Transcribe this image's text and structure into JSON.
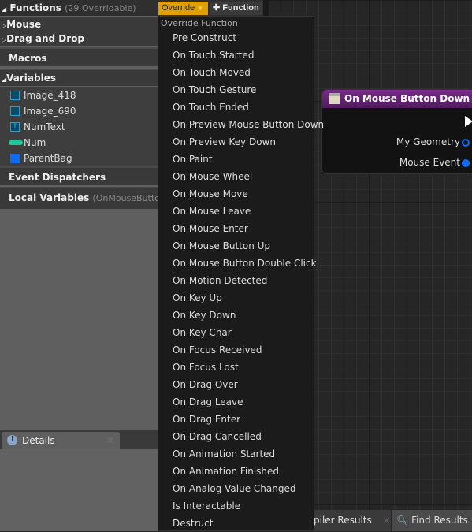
{
  "functions": {
    "title": "Functions",
    "count": "(29 Overridable)",
    "override_label": "Override",
    "add_label": "Function",
    "categories": [
      "Mouse",
      "Drag and Drop"
    ]
  },
  "macros": "Macros",
  "variables": {
    "title": "Variables",
    "items": [
      {
        "name": "Image_418",
        "icon": "image-widget-icon",
        "color": "#1ea0d8"
      },
      {
        "name": "Image_690",
        "icon": "image-widget-icon",
        "color": "#1ea0d8"
      },
      {
        "name": "NumText",
        "icon": "text-widget-icon",
        "color": "#1ea0d8"
      },
      {
        "name": "Num",
        "icon": "integer-pill-icon",
        "color": "#1fc89a"
      },
      {
        "name": "ParentBag",
        "icon": "object-icon",
        "color": "#0f6cf0"
      }
    ]
  },
  "event_dispatchers": "Event Dispatchers",
  "local_variables": {
    "title": "Local Variables",
    "context": "(OnMouseButtonDo"
  },
  "menu": {
    "header": "Override Function",
    "items": [
      "Pre Construct",
      "On Touch Started",
      "On Touch Moved",
      "On Touch Gesture",
      "On Touch Ended",
      "On Preview Mouse Button Down",
      "On Preview Key Down",
      "On Paint",
      "On Mouse Wheel",
      "On Mouse Move",
      "On Mouse Leave",
      "On Mouse Enter",
      "On Mouse Button Up",
      "On Mouse Button Double Click",
      "On Motion Detected",
      "On Key Up",
      "On Key Down",
      "On Key Char",
      "On Focus Received",
      "On Focus Lost",
      "On Drag Over",
      "On Drag Leave",
      "On Drag Enter",
      "On Drag Cancelled",
      "On Animation Started",
      "On Animation Finished",
      "On Analog Value Changed",
      "Is Interactable",
      "Destruct"
    ]
  },
  "node": {
    "title": "On Mouse Button Down",
    "pins": [
      "My Geometry",
      "Mouse Event"
    ],
    "accent": "#7a2a8c"
  },
  "details_tab": "Details",
  "bottom_tabs": [
    "piler Results",
    "Find Results"
  ]
}
